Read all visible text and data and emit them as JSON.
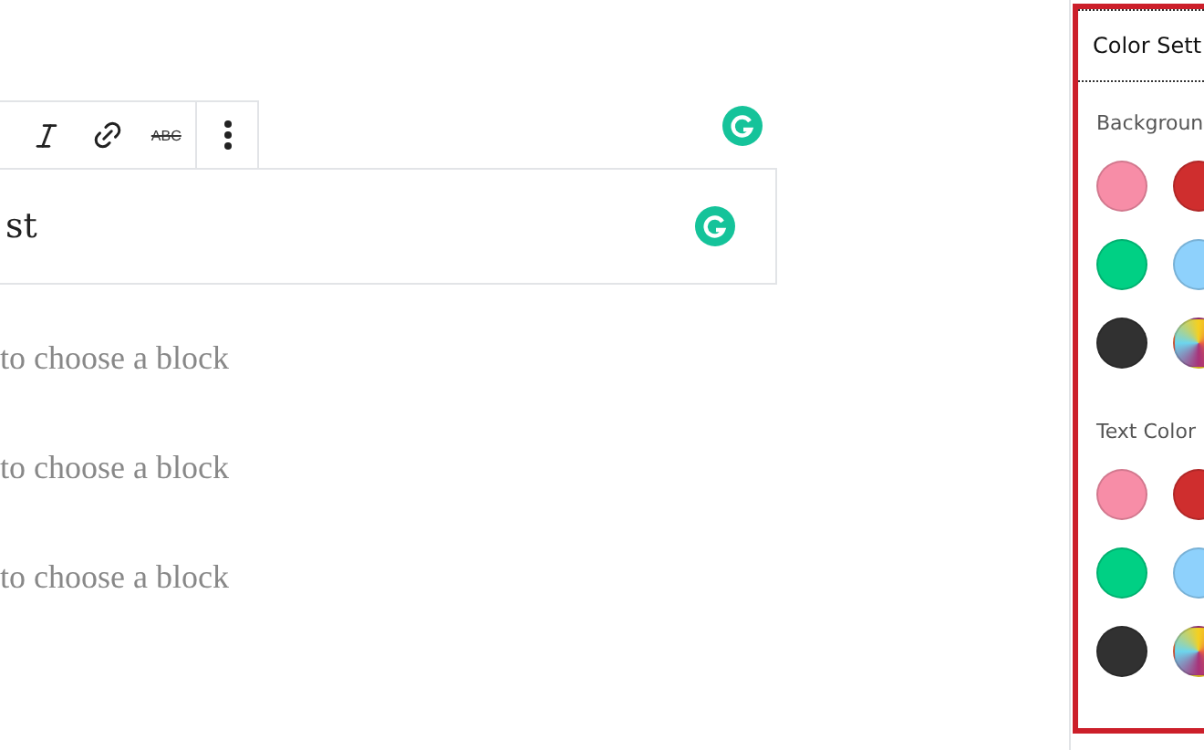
{
  "editor": {
    "toolbar": {
      "strikethrough_label": "ABC"
    },
    "block_text": "st",
    "placeholders": [
      "to choose a block",
      "to choose a block",
      "to choose a block"
    ]
  },
  "panel": {
    "title": "Color Sett",
    "sections": [
      {
        "label": "Backgroun",
        "swatches": [
          {
            "kind": "solid",
            "color": "#f78da7"
          },
          {
            "kind": "solid",
            "color": "#cf2e2e"
          },
          {
            "kind": "solid",
            "color": "#00d084"
          },
          {
            "kind": "solid",
            "color": "#8ed1fc"
          },
          {
            "kind": "solid",
            "color": "#313131"
          },
          {
            "kind": "custom"
          }
        ]
      },
      {
        "label": "Text Color",
        "swatches": [
          {
            "kind": "solid",
            "color": "#f78da7"
          },
          {
            "kind": "solid",
            "color": "#cf2e2e"
          },
          {
            "kind": "solid",
            "color": "#00d084"
          },
          {
            "kind": "solid",
            "color": "#8ed1fc"
          },
          {
            "kind": "solid",
            "color": "#313131"
          },
          {
            "kind": "custom"
          }
        ]
      }
    ]
  }
}
